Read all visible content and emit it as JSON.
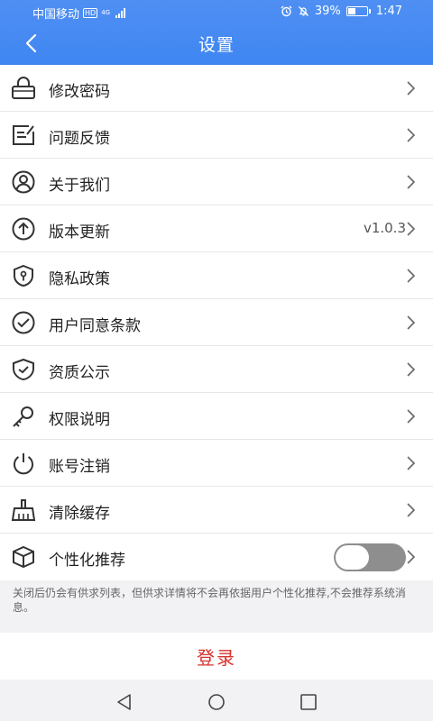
{
  "status_bar": {
    "carrier": "中国移动",
    "hd": "HD",
    "network": "4G",
    "battery": "39%",
    "time": "1:47"
  },
  "header": {
    "title": "设置"
  },
  "items": [
    {
      "label": "修改密码",
      "value": "",
      "icon": "lock-icon"
    },
    {
      "label": "问题反馈",
      "value": "",
      "icon": "feedback-icon"
    },
    {
      "label": "关于我们",
      "value": "",
      "icon": "user-circle-icon"
    },
    {
      "label": "版本更新",
      "value": "v1.0.3",
      "icon": "upload-arrow-icon"
    },
    {
      "label": "隐私政策",
      "value": "",
      "icon": "privacy-shield-icon"
    },
    {
      "label": "用户同意条款",
      "value": "",
      "icon": "check-circle-icon"
    },
    {
      "label": "资质公示",
      "value": "",
      "icon": "check-shield-icon"
    },
    {
      "label": "权限说明",
      "value": "",
      "icon": "key-icon"
    },
    {
      "label": "账号注销",
      "value": "",
      "icon": "power-icon"
    },
    {
      "label": "清除缓存",
      "value": "",
      "icon": "broom-icon"
    },
    {
      "label": "个性化推荐",
      "value": "",
      "icon": "cube-icon",
      "toggle_on": false
    }
  ],
  "notice": "关闭后仍会有供求列表，但供求详情将不会再依据用户个性化推荐,不会推荐系统消息。",
  "login_label": "登录",
  "colors": {
    "accent": "#4a8cf3",
    "login": "#d7312e",
    "toggle_off": "#8e8e8e"
  }
}
